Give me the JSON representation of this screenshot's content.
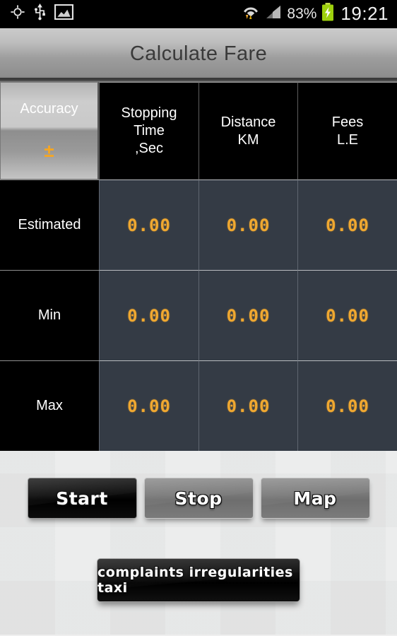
{
  "statusbar": {
    "icons_left": [
      "gps-location-icon",
      "usb-icon",
      "screenshot-image-icon"
    ],
    "icons_right": [
      "wifi-data-icon",
      "cellular-signal-icon",
      "battery-charging-icon"
    ],
    "battery_percent": "83%",
    "time": "19:21"
  },
  "header": {
    "title": "Calculate Fare"
  },
  "table": {
    "columns": [
      {
        "id": "accuracy",
        "label": "Accuracy",
        "symbol": "±"
      },
      {
        "id": "stopping_time",
        "label": "Stopping\nTime\n,Sec",
        "line1": "Stopping",
        "line2": "Time",
        "line3": ",Sec"
      },
      {
        "id": "distance",
        "line1": "Distance",
        "line2": "KM"
      },
      {
        "id": "fees",
        "line1": "Fees",
        "line2": "L.E"
      }
    ],
    "rows": [
      {
        "label": "Estimated",
        "stopping_time": "0.00",
        "distance": "0.00",
        "fees": "0.00"
      },
      {
        "label": "Min",
        "stopping_time": "0.00",
        "distance": "0.00",
        "fees": "0.00"
      },
      {
        "label": "Max",
        "stopping_time": "0.00",
        "distance": "0.00",
        "fees": "0.00"
      }
    ]
  },
  "buttons": {
    "start": "Start",
    "stop": "Stop",
    "map": "Map",
    "complaints": "complaints irregularities taxi"
  },
  "colors": {
    "lcd_amber": "#f0a830",
    "accent_orange": "#f5a623",
    "cell_dark": "#343b45",
    "battery_green": "#99cc00"
  }
}
